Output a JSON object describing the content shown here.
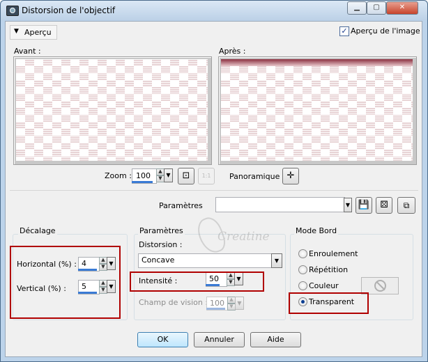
{
  "window": {
    "title": "Distorsion de l'objectif"
  },
  "preview": {
    "toggle_label": "Aperçu",
    "image_preview_label": "Aperçu de l'image",
    "image_preview_checked": true,
    "before_label": "Avant :",
    "after_label": "Après :",
    "zoom_label": "Zoom :",
    "zoom_value": "100",
    "pan_label": "Panoramique :"
  },
  "presets": {
    "label": "Paramètres",
    "value": ""
  },
  "offset": {
    "title": "Décalage",
    "horizontal_label": "Horizontal (%) :",
    "horizontal_value": "4",
    "vertical_label": "Vertical (%) :",
    "vertical_value": "5"
  },
  "params": {
    "title": "Paramètres",
    "distortion_label": "Distorsion :",
    "distortion_value": "Concave",
    "intensity_label": "Intensité :",
    "intensity_value": "50",
    "fov_label": "Champ de vision :",
    "fov_value": "100"
  },
  "watermark": "Creatine",
  "edge": {
    "title": "Mode Bord",
    "options": [
      "Enroulement",
      "Répétition",
      "Couleur",
      "Transparent"
    ],
    "selected": "Transparent"
  },
  "buttons": {
    "ok": "OK",
    "cancel": "Annuler",
    "help": "Aide"
  },
  "colors": {
    "accent": "#3a7bd5",
    "highlight_box": "#b00000",
    "checker": "#e8d4d6"
  }
}
